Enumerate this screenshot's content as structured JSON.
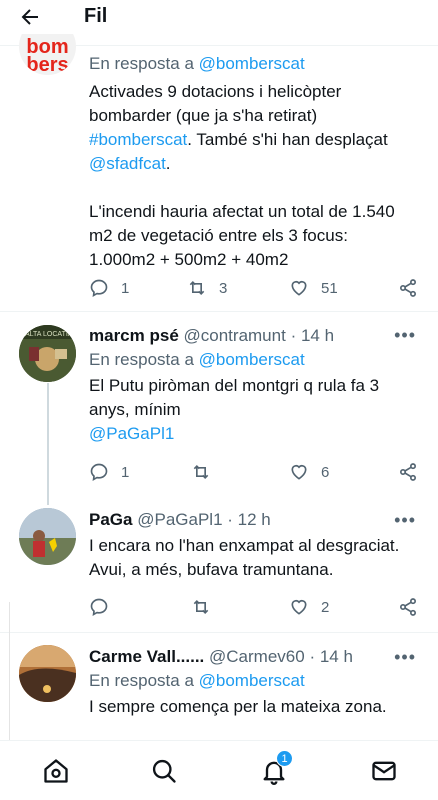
{
  "header": {
    "title": "Fil"
  },
  "tweets": [
    {
      "avatar_text": "bom\nbers",
      "reply_prefix": "En resposta a",
      "reply_handle": "@bomberscat",
      "text_lines": [
        "Activades 9 dotacions i helicòpter",
        "bombarder (que ja s'ha retirat)"
      ],
      "hashtag": "#bomberscat",
      "text_after_hashtag": ". També s'hi han desplaçat",
      "mention": "@sfadfcat",
      "text_after_mention": ".",
      "text_lines_2": [
        "L'incendi hauria afectat un total de 1.540",
        "m2 de vegetació entre els 3 focus:",
        "1.000m2 + 500m2 + 40m2"
      ],
      "replies": "1",
      "retweets": "3",
      "likes": "51"
    },
    {
      "name": "marcm psé",
      "handle": "@contramunt",
      "time": "· 14 h",
      "reply_prefix": "En resposta a",
      "reply_handle": "@bomberscat",
      "text_lines": [
        "El Putu piròman del montgri q rula fa 3",
        "anys, mínim"
      ],
      "mention": "@PaGaPl1",
      "replies": "1",
      "retweets": "",
      "likes": "6"
    },
    {
      "name": "PaGa",
      "handle": "@PaGaPl1",
      "time": "· 12 h",
      "text_lines": [
        "I encara no l'han enxampat al desgraciat.",
        "Avui, a més, bufava tramuntana."
      ],
      "replies": "",
      "retweets": "",
      "likes": "2"
    },
    {
      "name": "Carme Vall......",
      "handle": "@Carmev60",
      "time": "· 14 h",
      "reply_prefix": "En resposta a",
      "reply_handle": "@bomberscat",
      "text_lines": [
        "I sempre comença per la mateixa zona."
      ]
    }
  ],
  "more_label": "•••",
  "notifications_badge": "1",
  "icons": {
    "back": "arrow-left-icon",
    "reply": "comment-icon",
    "retweet": "retweet-icon",
    "like": "heart-icon",
    "share": "share-icon",
    "home": "home-icon",
    "search": "search-icon",
    "notifications": "bell-icon",
    "messages": "mail-icon"
  },
  "colors": {
    "link": "#1d9bf0",
    "secondary": "#536471",
    "bombers_red": "#e4251b"
  }
}
